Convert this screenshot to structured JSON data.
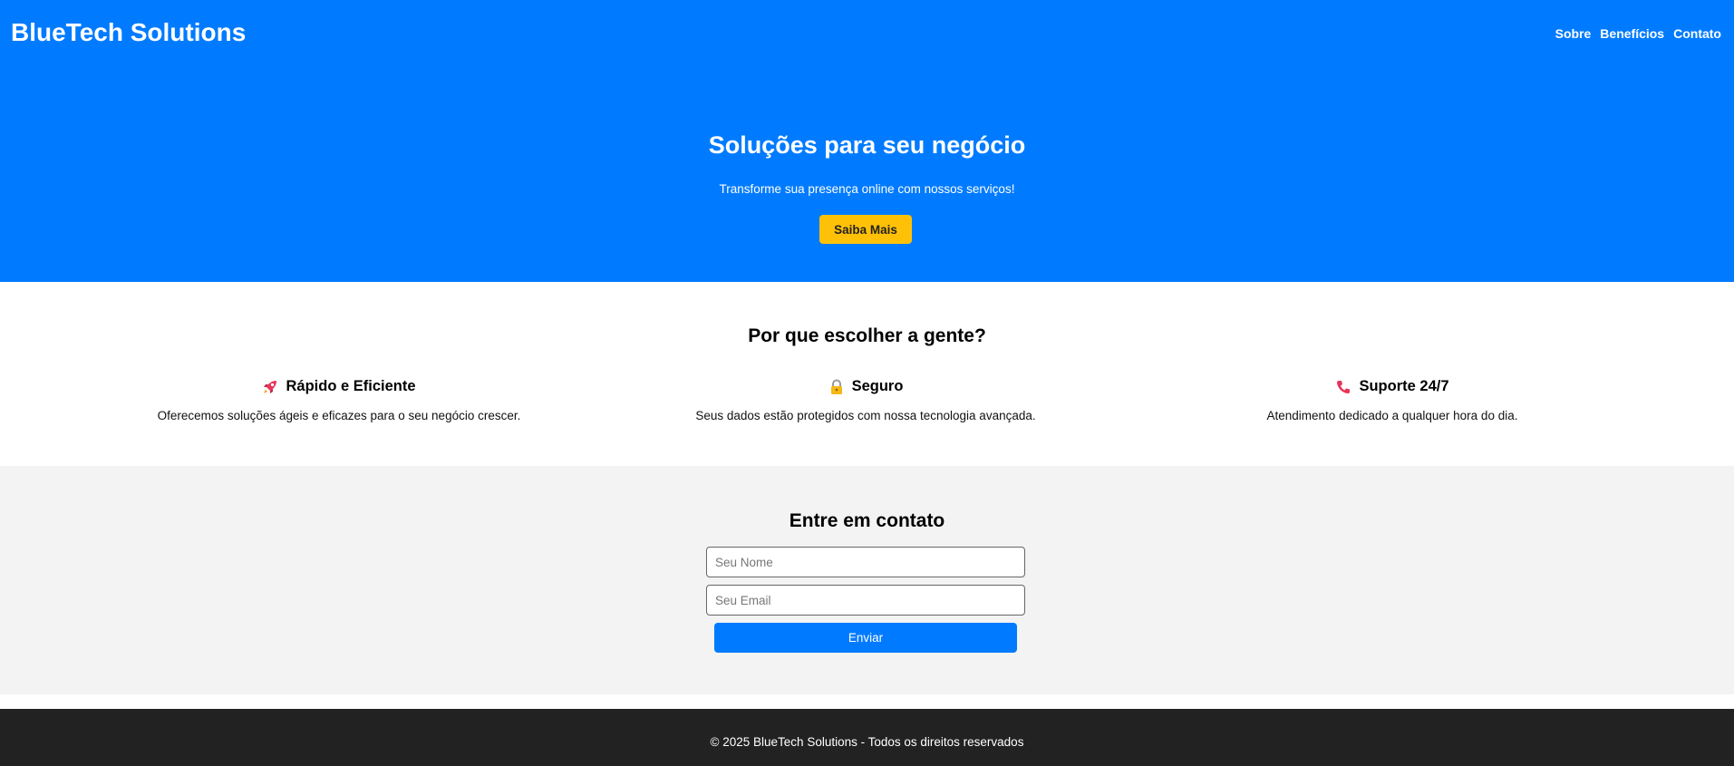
{
  "header": {
    "brand": "BlueTech Solutions",
    "nav": [
      {
        "label": "Sobre"
      },
      {
        "label": "Benefícios"
      },
      {
        "label": "Contato"
      }
    ]
  },
  "hero": {
    "title": "Soluções para seu negócio",
    "subtitle": "Transforme sua presença online com nossos serviços!",
    "cta_label": "Saiba Mais"
  },
  "benefits": {
    "title": "Por que escolher a gente?",
    "items": [
      {
        "icon": "rocket-icon",
        "title": "Rápido e Eficiente",
        "description": "Oferecemos soluções ágeis e eficazes para o seu negócio crescer."
      },
      {
        "icon": "lock-icon",
        "title": "Seguro",
        "description": "Seus dados estão protegidos com nossa tecnologia avançada."
      },
      {
        "icon": "phone-icon",
        "title": "Suporte 24/7",
        "description": "Atendimento dedicado a qualquer hora do dia."
      }
    ]
  },
  "contact": {
    "title": "Entre em contato",
    "name_placeholder": "Seu Nome",
    "email_placeholder": "Seu Email",
    "name_value": "",
    "email_value": "",
    "submit_label": "Enviar"
  },
  "footer": {
    "text": "© 2025 BlueTech Solutions - Todos os direitos reservados"
  },
  "colors": {
    "primary": "#007bff",
    "accent": "#ffc107",
    "section_bg": "#f3f3f3",
    "footer_bg": "#222222"
  }
}
